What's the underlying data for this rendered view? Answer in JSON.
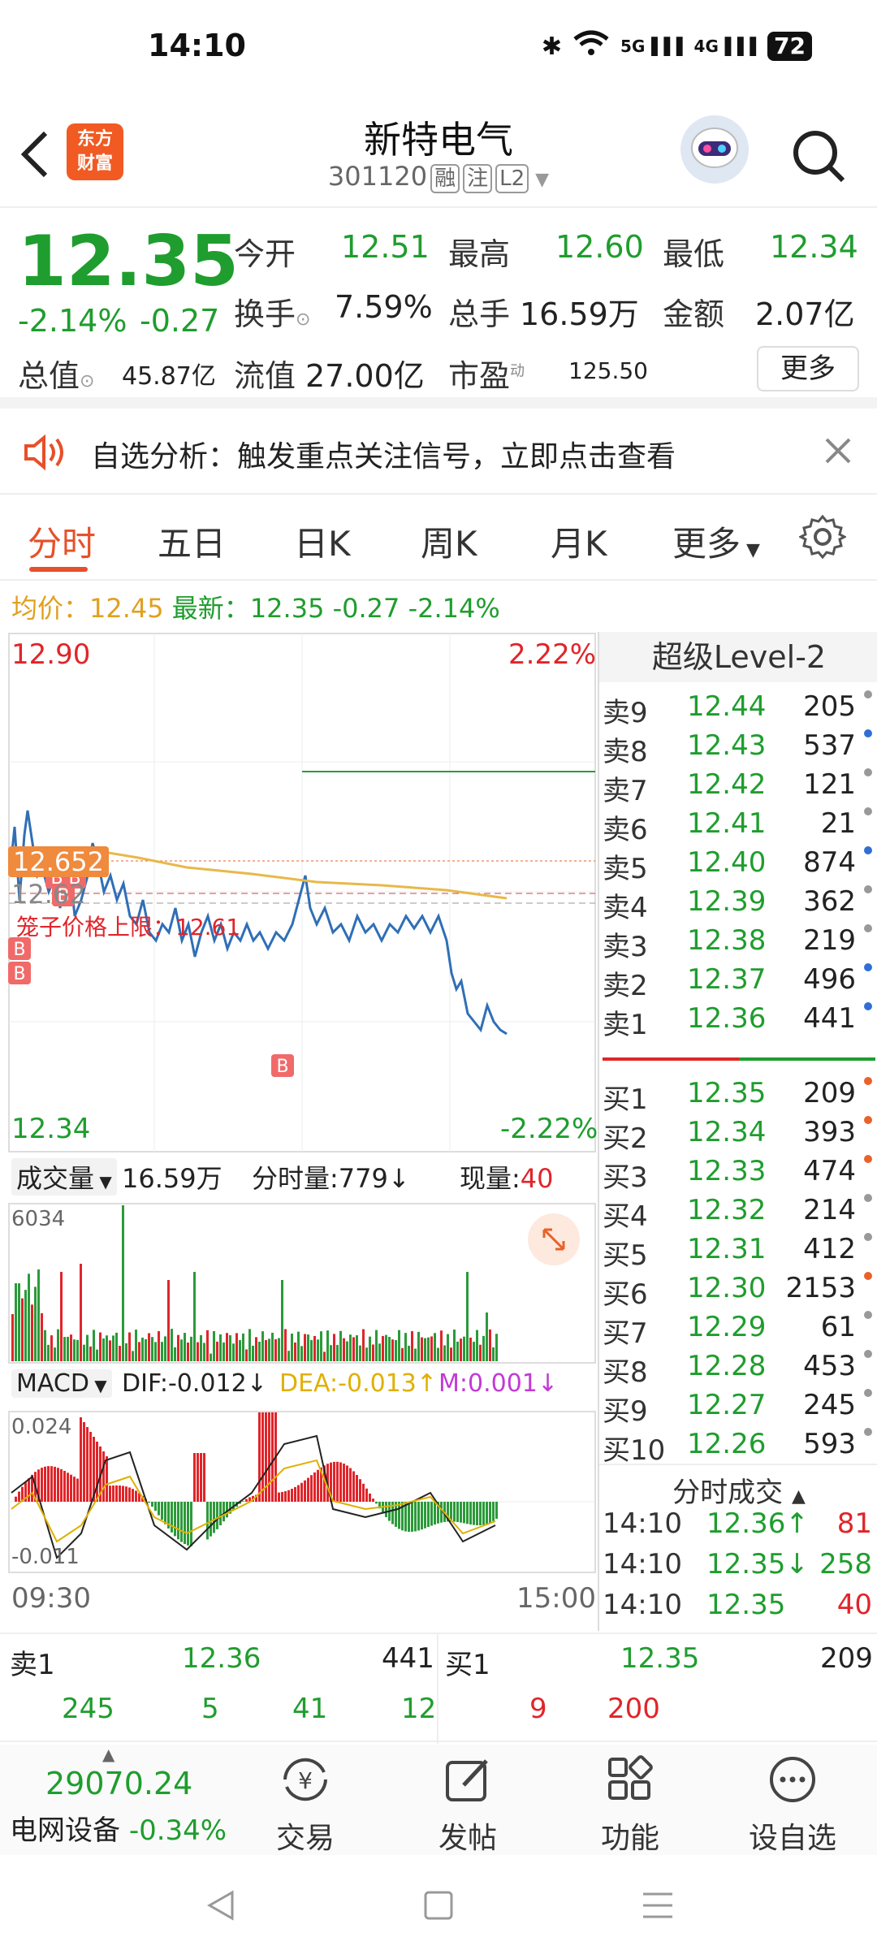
{
  "status": {
    "time": "14:10",
    "battery": "72",
    "signal1": "5G",
    "signal2": "4G"
  },
  "header": {
    "logo_line1": "东方",
    "logo_line2": "财富",
    "title": "新特电气",
    "code": "301120",
    "tags": [
      "融",
      "注",
      "L2"
    ]
  },
  "quote": {
    "price": "12.35",
    "pct": "-2.14%",
    "chg": "-0.27",
    "open_label": "今开",
    "open": "12.51",
    "high_label": "最高",
    "high": "12.60",
    "low_label": "最低",
    "low": "12.34",
    "turnover_label": "换手",
    "turnover": "7.59%",
    "volume_label": "总手",
    "volume": "16.59万",
    "amount_label": "金额",
    "amount": "2.07亿",
    "mktcap_label": "总值",
    "mktcap": "45.87亿",
    "float_label": "流值",
    "float": "27.00亿",
    "pe_label": "市盈",
    "pe_sup": "动",
    "pe": "125.50",
    "more": "更多"
  },
  "notice": {
    "text": "自选分析：触发重点关注信号，立即点击查看"
  },
  "tabs": [
    "分时",
    "五日",
    "日K",
    "周K",
    "月K",
    "更多"
  ],
  "info": {
    "avg_label": "均价：",
    "avg": "12.45",
    "last_label": "最新：",
    "last": "12.35",
    "chg": "-0.27",
    "pct": "-2.14%"
  },
  "chart": {
    "y_top": "12.90",
    "y_top_pct": "2.22%",
    "y_bottom": "12.34",
    "y_bottom_pct": "-2.22%",
    "marker_price": "12.652",
    "ref_price": "12.62",
    "limit_label": "笼子价格上限：12.61",
    "vol_label": "成交量",
    "vol_total": "16.59万",
    "tick_label": "分时量:779↓",
    "now_label": "现量:",
    "now_val": "40",
    "vol_max": "6034",
    "macd_label": "MACD",
    "dif": "DIF:-0.012↓",
    "dea": "DEA:-0.013↑",
    "m": "M:0.001↓",
    "macd_top": "0.024",
    "macd_bottom": "-0.011",
    "time_start": "09:30",
    "time_end": "15:00",
    "signal_mark": "B"
  },
  "panel": {
    "title": "超级Level-2",
    "asks": [
      {
        "label": "卖9",
        "price": "12.44",
        "vol": "205",
        "dot": "#999"
      },
      {
        "label": "卖8",
        "price": "12.43",
        "vol": "537",
        "dot": "#2f6fd6"
      },
      {
        "label": "卖7",
        "price": "12.42",
        "vol": "121",
        "dot": "#999"
      },
      {
        "label": "卖6",
        "price": "12.41",
        "vol": "21",
        "dot": "#999"
      },
      {
        "label": "卖5",
        "price": "12.40",
        "vol": "874",
        "dot": "#2f6fd6"
      },
      {
        "label": "卖4",
        "price": "12.39",
        "vol": "362",
        "dot": "#999"
      },
      {
        "label": "卖3",
        "price": "12.38",
        "vol": "219",
        "dot": "#999"
      },
      {
        "label": "卖2",
        "price": "12.37",
        "vol": "496",
        "dot": "#2f6fd6"
      },
      {
        "label": "卖1",
        "price": "12.36",
        "vol": "441",
        "dot": "#2f6fd6"
      }
    ],
    "bids": [
      {
        "label": "买1",
        "price": "12.35",
        "vol": "209",
        "dot": "#e8622a"
      },
      {
        "label": "买2",
        "price": "12.34",
        "vol": "393",
        "dot": "#e8622a"
      },
      {
        "label": "买3",
        "price": "12.33",
        "vol": "474",
        "dot": "#e8622a"
      },
      {
        "label": "买4",
        "price": "12.32",
        "vol": "214",
        "dot": "#999"
      },
      {
        "label": "买5",
        "price": "12.31",
        "vol": "412",
        "dot": "#999"
      },
      {
        "label": "买6",
        "price": "12.30",
        "vol": "2153",
        "dot": "#e8622a"
      },
      {
        "label": "买7",
        "price": "12.29",
        "vol": "61",
        "dot": "#999"
      },
      {
        "label": "买8",
        "price": "12.28",
        "vol": "453",
        "dot": "#999"
      },
      {
        "label": "买9",
        "price": "12.27",
        "vol": "245",
        "dot": "#999"
      },
      {
        "label": "买10",
        "price": "12.26",
        "vol": "593",
        "dot": "#999"
      }
    ],
    "trades_title": "分时成交",
    "trades": [
      {
        "time": "14:10",
        "price": "12.36↑",
        "vol": "81"
      },
      {
        "time": "14:10",
        "price": "12.35↓",
        "vol": "258"
      },
      {
        "time": "14:10",
        "price": "12.35",
        "vol": "40"
      }
    ]
  },
  "book": {
    "ask_label": "卖1",
    "ask_price": "12.36",
    "ask_vol": "441",
    "bid_label": "买1",
    "bid_price": "12.35",
    "bid_vol": "209",
    "left_nums": [
      "245",
      "5",
      "41",
      "12"
    ],
    "right_nums": [
      "9",
      "200"
    ]
  },
  "toolbar": {
    "index_value": "29070.24",
    "index_name": "电网设备",
    "index_pct": "-0.34%",
    "trade": "交易",
    "post": "发帖",
    "func": "功能",
    "watch": "设自选"
  }
}
